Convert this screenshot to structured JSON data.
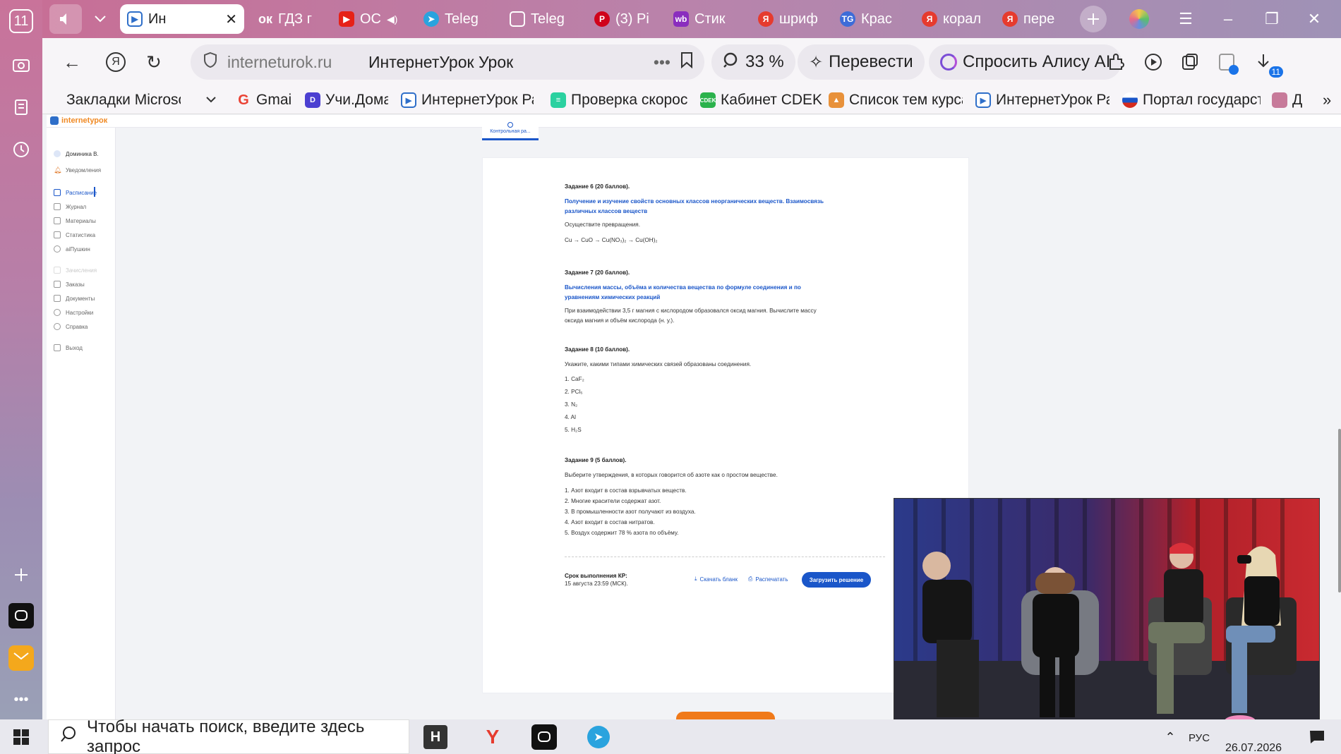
{
  "leftbar": {
    "tab_count": "11"
  },
  "tabs": [
    {
      "label": "Ин",
      "favicon": "play-icon",
      "color": "#2f6fc9"
    },
    {
      "label": "ГДЗ г",
      "favicon": "ok-icon",
      "color": "#ffffff"
    },
    {
      "label": "ОС",
      "favicon": "youtube-icon",
      "color": "#e62117"
    },
    {
      "label": "Teleg",
      "favicon": "telegram-icon",
      "color": "#2aa3de"
    },
    {
      "label": "Teleg",
      "favicon": "document-icon",
      "color": "#ffffff"
    },
    {
      "label": "(3) Pi",
      "favicon": "pinterest-icon",
      "color": "#d0021b"
    },
    {
      "label": "Стик",
      "favicon": "wildberries-icon",
      "color": "#8a2dbe"
    },
    {
      "label": "шриф",
      "favicon": "yandex-icon",
      "color": "#e63b2e"
    },
    {
      "label": "Крас",
      "favicon": "tg-icon",
      "color": "#3d6cd8"
    },
    {
      "label": "корал",
      "favicon": "yandex-icon",
      "color": "#e63b2e"
    },
    {
      "label": "пере",
      "favicon": "yandex-icon",
      "color": "#e63b2e"
    }
  ],
  "toolbar": {
    "url": "interneturok.ru",
    "page_title": "ИнтернетУрок Урок",
    "zoom": "33 %",
    "translate": "Перевести",
    "alice": "Спросить Алису AI",
    "downloads_badge": "11"
  },
  "bookmarks": [
    {
      "label": "Закладки Microsoft E",
      "color": ""
    },
    {
      "label": "Gmail",
      "color": "#ea4335"
    },
    {
      "label": "Учи.Дома",
      "color": "#4b3fd1"
    },
    {
      "label": "ИнтернетУрок Ра",
      "color": "#2f6fc9"
    },
    {
      "label": "Проверка скорос",
      "color": "#2bd1a0"
    },
    {
      "label": "Кабинет CDEK",
      "color": "#2bb24c"
    },
    {
      "label": "Список тем курса",
      "color": "#e8913a"
    },
    {
      "label": "ИнтернетУрок Ра",
      "color": "#2f6fc9"
    },
    {
      "label": "Портал государст",
      "color": "#d52b1e"
    },
    {
      "label": "Д",
      "color": "#c77a9a"
    }
  ],
  "site": {
    "logo_text": "internetурок",
    "user": "Доминика В.",
    "notifications": "Уведомления",
    "menu": [
      "Расписание",
      "Журнал",
      "Материалы",
      "Статистика",
      "aiПушкин"
    ],
    "menu_muted": "Зачисления",
    "menu2": [
      "Заказы",
      "Документы",
      "Настройки",
      "Справка"
    ],
    "logout": "Выход",
    "tab_chip": "Контрольная ра..."
  },
  "tasks": {
    "t6_title": "Задание 6 (20 баллов).",
    "t6_topic": "Получение и изучение свойств основных классов неорганических веществ. Взаимосвязь различных классов веществ",
    "t6_text": "Осуществите превращения.",
    "t6_chain": "Cu → CuO → Cu(NO₃)₂ → Cu(OH)₂",
    "t7_title": "Задание 7 (20 баллов).",
    "t7_topic": "Вычисления массы, объёма и количества вещества по формуле соединения и по уравнениям химических реакций",
    "t7_text": "При взаимодействии 3,5 г магния с кислородом образовался оксид магния. Вычислите массу оксида магния и объём кислорода (н. у.).",
    "t8_title": "Задание 8 (10 баллов).",
    "t8_text": "Укажите, какими типами химических связей образованы соединения.",
    "t8_items": [
      "1. CaF₂",
      "2. PCl₅",
      "3. N₂",
      "4. Al",
      "5. H₂S"
    ],
    "t9_title": "Задание 9 (5 баллов).",
    "t9_text": "Выберите утверждения, в которых говорится об азоте как о простом веществе.",
    "t9_items": [
      "1. Азот входит в состав взрывчатых веществ.",
      "2. Многие красители содержат азот.",
      "3. В промышленности азот получают из воздуха.",
      "4. Азот входит в состав нитратов.",
      "5. Воздух содержит 78 % азота по объёму."
    ],
    "deadline_label": "Срок выполнения КР:",
    "deadline_value": "15 августа 23:59 (МСК).",
    "download_blank": "Скачать бланк",
    "print": "Распечатать",
    "upload": "Загрузить решение"
  },
  "taskbar": {
    "search_placeholder": "Чтобы начать поиск, введите здесь запрос",
    "lang": "РУС",
    "date": "26.07.2026"
  }
}
